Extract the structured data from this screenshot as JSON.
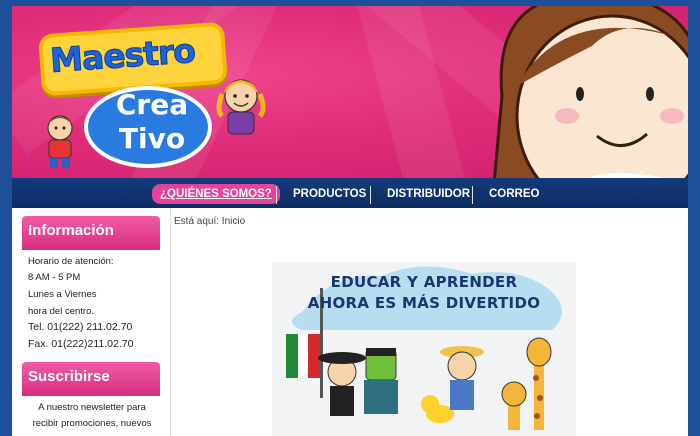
{
  "brand": {
    "logo_line1": "Maestro",
    "logo_line2": "Crea",
    "logo_line3": "Tivo"
  },
  "nav": {
    "items": [
      {
        "label": "¿QUIÉNES SOMOS?"
      },
      {
        "label": "PRODUCTOS"
      },
      {
        "label": "DISTRIBUIDOR"
      },
      {
        "label": "CORREO"
      }
    ]
  },
  "sidebar": {
    "info_title": "Información",
    "info_lines": [
      "Horario de atención:",
      "8 AM - 5 PM",
      "Lunes a Viernes",
      "hora del centro.",
      "Tel.  01(222) 211.02.70",
      "Fax.  01(222)211.02.70"
    ],
    "subscribe_title": "Suscribirse",
    "subscribe_text": "A nuestro newsletter para recibir promociones, nuevos"
  },
  "breadcrumb": "Está aquí: Inicio",
  "promo": {
    "line1": "EDUCAR Y APRENDER",
    "line2": "AHORA ES MÁS DIVERTIDO"
  },
  "colors": {
    "brand_pink": "#e02d7a",
    "nav_blue": "#133a7c",
    "accent_pink": "#e8419a"
  }
}
